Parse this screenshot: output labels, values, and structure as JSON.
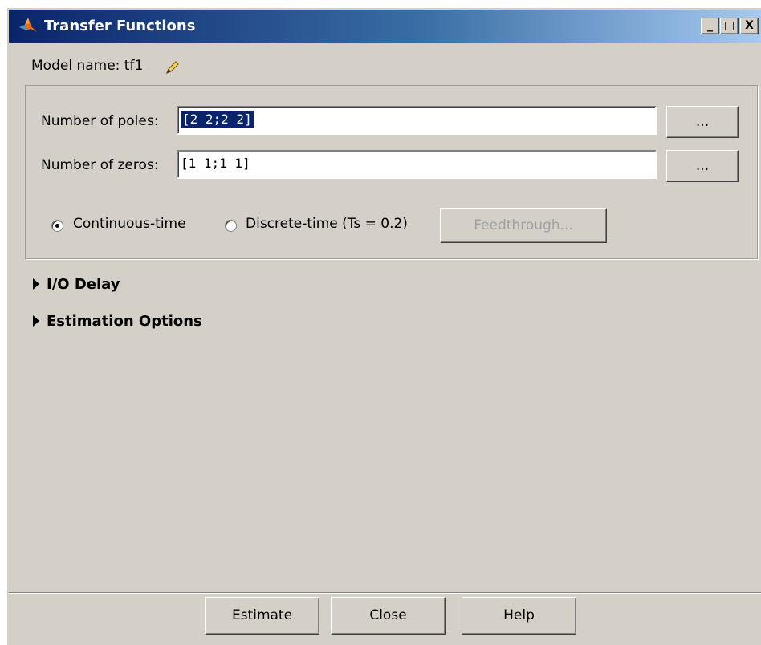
{
  "window": {
    "title": "Transfer Functions",
    "controls": {
      "minimize": "_",
      "maximize": "□",
      "close": "X"
    }
  },
  "model": {
    "label": "Model name: tf1",
    "edit_icon": "pencil-icon"
  },
  "poles": {
    "label": "Number of poles:",
    "value": "[2 2;2 2]",
    "browse": "..."
  },
  "zeros": {
    "label": "Number of zeros:",
    "value": "[1 1;1 1]",
    "browse": "..."
  },
  "time_domain": {
    "continuous_label": "Continuous-time",
    "discrete_label": "Discrete-time (Ts = 0.2)",
    "selected": "continuous",
    "feedthrough": "Feedthrough..."
  },
  "sections": {
    "io_delay": "I/O Delay",
    "estimation_options": "Estimation Options"
  },
  "footer": {
    "estimate": "Estimate",
    "close": "Close",
    "help": "Help"
  },
  "colors": {
    "title_bar": "#0a246a",
    "window_bg": "#d4d0c8",
    "selection": "#0a246a"
  }
}
